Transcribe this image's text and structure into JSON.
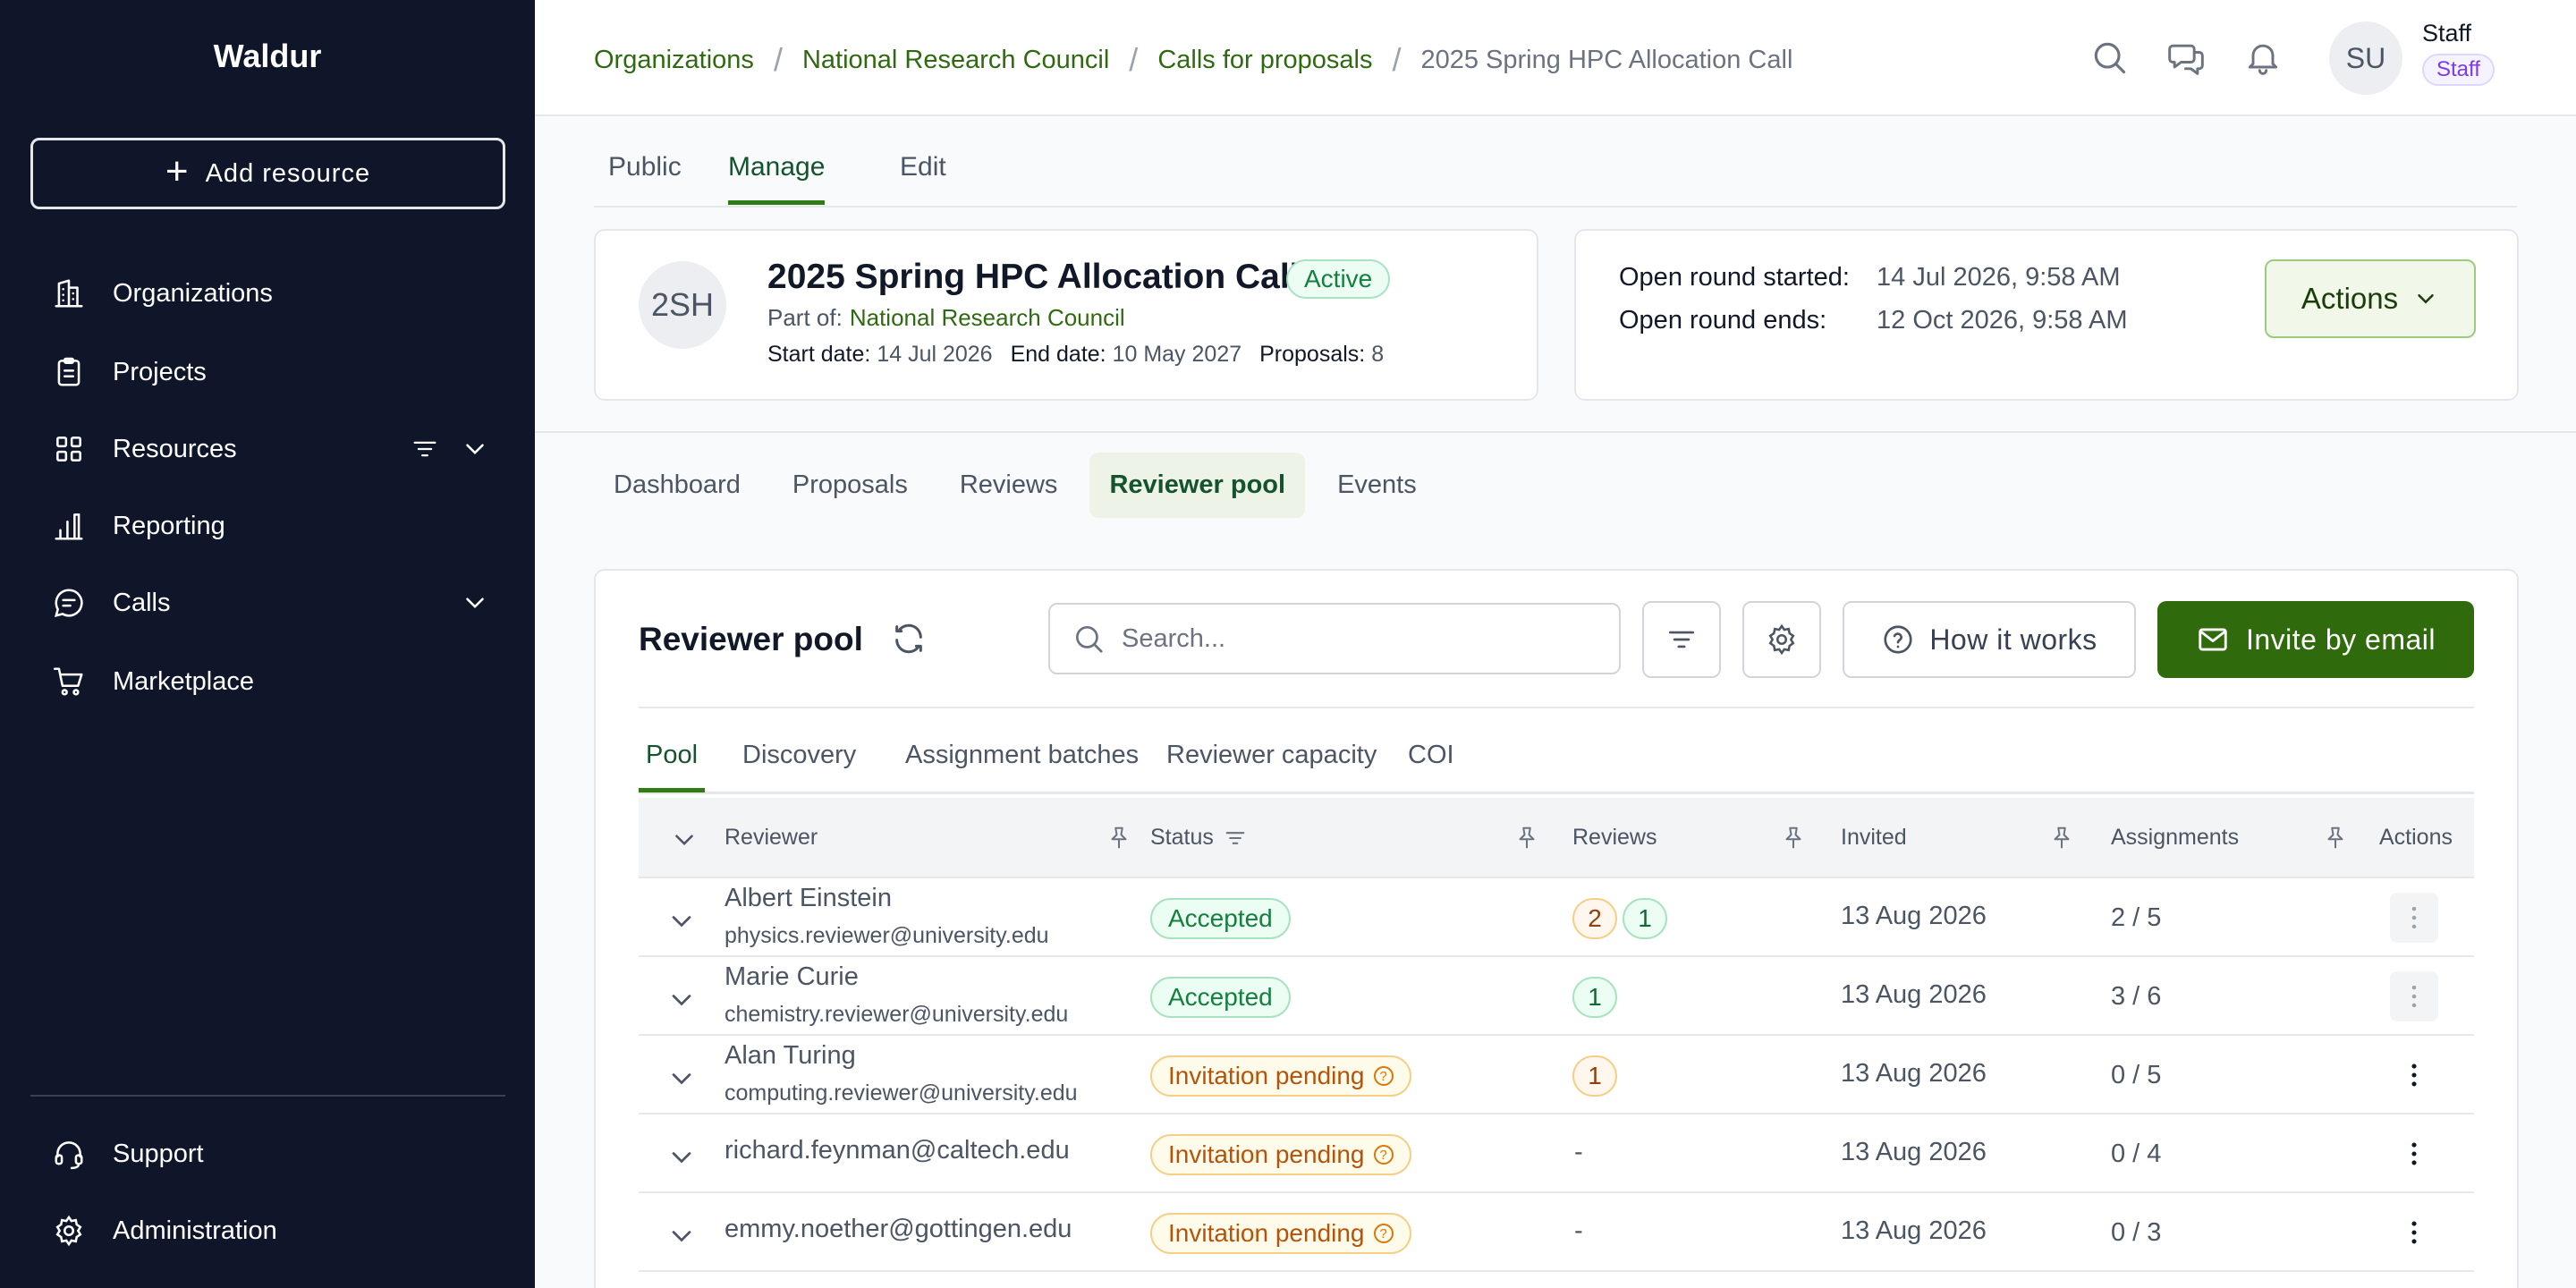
{
  "app": {
    "brand": "Waldur"
  },
  "sidebar": {
    "add_resource": "Add resource",
    "items": [
      {
        "label": "Organizations",
        "icon": "building-icon"
      },
      {
        "label": "Projects",
        "icon": "clipboard-icon"
      },
      {
        "label": "Resources",
        "icon": "grid-icon"
      },
      {
        "label": "Reporting",
        "icon": "bar-chart-icon"
      },
      {
        "label": "Calls",
        "icon": "message-icon"
      },
      {
        "label": "Marketplace",
        "icon": "cart-icon"
      }
    ],
    "footer": [
      {
        "label": "Support",
        "icon": "headset-icon"
      },
      {
        "label": "Administration",
        "icon": "gear-icon"
      }
    ]
  },
  "breadcrumb": [
    "Organizations",
    "National Research Council",
    "Calls for proposals",
    "2025 Spring HPC Allocation Call"
  ],
  "user": {
    "initials": "SU",
    "name": "Staff",
    "role": "Staff"
  },
  "top_tabs": [
    "Public",
    "Manage",
    "Edit"
  ],
  "call": {
    "initials": "2SH",
    "title": "2025 Spring HPC Allocation Call",
    "status": "Active",
    "part_of_label": "Part of:",
    "part_of": "National Research Council",
    "start_label": "Start date:",
    "start": "14 Jul 2026",
    "end_label": "End date:",
    "end": "10 May 2027",
    "proposals_label": "Proposals:",
    "proposals": "8"
  },
  "round": {
    "started_label": "Open round started:",
    "started": "14 Jul 2026, 9:58 AM",
    "ends_label": "Open round ends:",
    "ends": "12 Oct 2026, 9:58 AM",
    "actions": "Actions"
  },
  "sub_tabs": [
    "Dashboard",
    "Proposals",
    "Reviews",
    "Reviewer pool",
    "Events"
  ],
  "pool": {
    "title": "Reviewer pool",
    "search_placeholder": "Search...",
    "how_it_works": "How it works",
    "invite": "Invite by email",
    "tabs": [
      "Pool",
      "Discovery",
      "Assignment batches",
      "Reviewer capacity",
      "COI"
    ],
    "columns": [
      "Reviewer",
      "Status",
      "Reviews",
      "Invited",
      "Assignments",
      "Actions"
    ],
    "rows": [
      {
        "name": "Albert Einstein",
        "email": "physics.reviewer@university.edu",
        "status": "Accepted",
        "reviews": [
          "2",
          "1"
        ],
        "invited": "13 Aug 2026",
        "assignments": "2 / 5"
      },
      {
        "name": "Marie Curie",
        "email": "chemistry.reviewer@university.edu",
        "status": "Accepted",
        "reviews": [
          "1"
        ],
        "invited": "13 Aug 2026",
        "assignments": "3 / 6"
      },
      {
        "name": "Alan Turing",
        "email": "computing.reviewer@university.edu",
        "status": "Invitation pending",
        "reviews": [
          "1"
        ],
        "invited": "13 Aug 2026",
        "assignments": "0 / 5"
      },
      {
        "name": "richard.feynman@caltech.edu",
        "email": "",
        "status": "Invitation pending",
        "reviews": "-",
        "invited": "13 Aug 2026",
        "assignments": "0 / 4"
      },
      {
        "name": "emmy.noether@gottingen.edu",
        "email": "",
        "status": "Invitation pending",
        "reviews": "-",
        "invited": "13 Aug 2026",
        "assignments": "0 / 3"
      }
    ]
  },
  "colors": {
    "sidebar_bg": "#0f1629",
    "accent": "#2f6b0c",
    "link": "#2f6a12"
  }
}
